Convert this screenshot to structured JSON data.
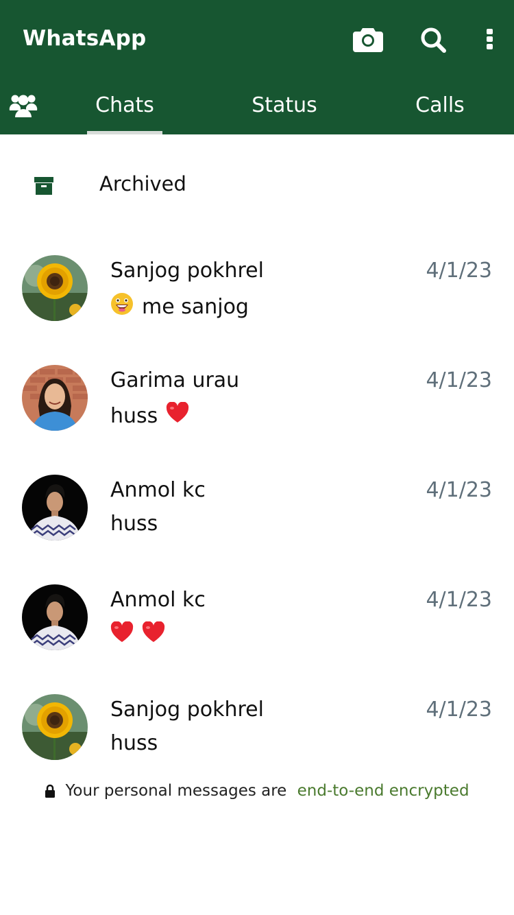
{
  "header": {
    "title": "WhatsApp",
    "icons": [
      "camera-icon",
      "search-icon",
      "more-vertical-icon"
    ],
    "color": "#175631"
  },
  "tabs": [
    {
      "label": "Chats",
      "active": true
    },
    {
      "label": "Status",
      "active": false
    },
    {
      "label": "Calls",
      "active": false
    }
  ],
  "archived": {
    "label": "Archived",
    "icon": "archive-box-icon"
  },
  "chats": [
    {
      "name": "Sanjog pokhrel",
      "time": "4/1/23",
      "message": "me sanjog",
      "message_emoji_prefix": "grinning-face-emoji",
      "avatar": "sunflower-photo"
    },
    {
      "name": "Garima urau",
      "time": "4/1/23",
      "message": "huss",
      "message_emoji_suffix": "red-heart-emoji",
      "avatar": "woman-brick-wall-photo"
    },
    {
      "name": "Anmol kc",
      "time": "4/1/23",
      "message": "huss",
      "avatar": "man-portrait-photo"
    },
    {
      "name": "Anmol kc",
      "time": "4/1/23",
      "message": "",
      "message_emojis": [
        "red-heart-emoji",
        "red-heart-emoji"
      ],
      "avatar": "man-portrait-photo"
    },
    {
      "name": "Sanjog pokhrel",
      "time": "4/1/23",
      "message": "huss",
      "avatar": "sunflower-photo"
    }
  ],
  "footer": {
    "text": "Your personal messages are",
    "link": "end-to-end encrypted",
    "link_color": "#4a7a2e"
  }
}
